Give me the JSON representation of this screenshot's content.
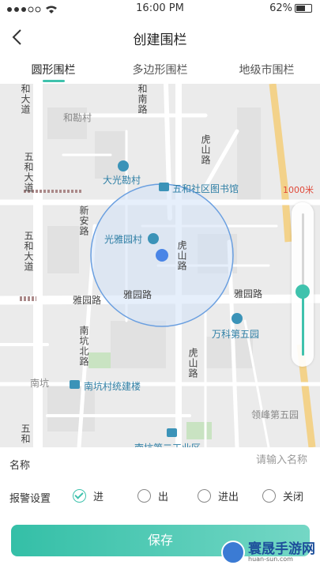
{
  "status": {
    "time": "16:00",
    "period": "PM",
    "battery": "62%",
    "battery_level": 0.62
  },
  "header": {
    "title": "创建围栏"
  },
  "tabs": [
    {
      "label": "圆形围栏",
      "active": true
    },
    {
      "label": "多边形围栏",
      "active": false
    },
    {
      "label": "地级市围栏",
      "active": false
    }
  ],
  "map": {
    "distance_label": "1000米",
    "zoom_level": 0.55,
    "roads": {
      "hedadao": "和大道",
      "wuhedadao": "五和大道",
      "wuhedadao2": "五和大道",
      "hunan": "和南路",
      "xinan": "新安路",
      "hushan1": "虎山路",
      "hushan2": "虎山路",
      "hushan3": "虎山路",
      "yayuan1": "雅园路",
      "yayuan2": "雅园路",
      "yayuan3": "雅园路",
      "nankengbei": "南坑北路",
      "wuhe_bottom": "五和"
    },
    "places": {
      "helicun": "和勘村",
      "daguang": "大光勘村",
      "library": "五和社区图书馆",
      "guangya": "光雅园村",
      "vanke": "万科第五园",
      "nankeng": "南坑",
      "nankengbuilding": "南坑村统建楼",
      "lingfeng": "领峰第五园",
      "bottom_cut": "南坑第二工业区"
    }
  },
  "form": {
    "name_label": "名称",
    "name_placeholder": "请输入名称",
    "alarm_label": "报警设置",
    "options": [
      {
        "label": "进",
        "checked": true
      },
      {
        "label": "出",
        "checked": false
      },
      {
        "label": "进出",
        "checked": false
      },
      {
        "label": "关闭",
        "checked": false
      }
    ],
    "save_label": "保存"
  },
  "watermark": {
    "title": "寰晟手游网",
    "url": "huan-sun.com"
  },
  "colors": {
    "accent": "#3fc2ad",
    "fence": "#6a9fe0",
    "distance": "#e04a3a"
  }
}
